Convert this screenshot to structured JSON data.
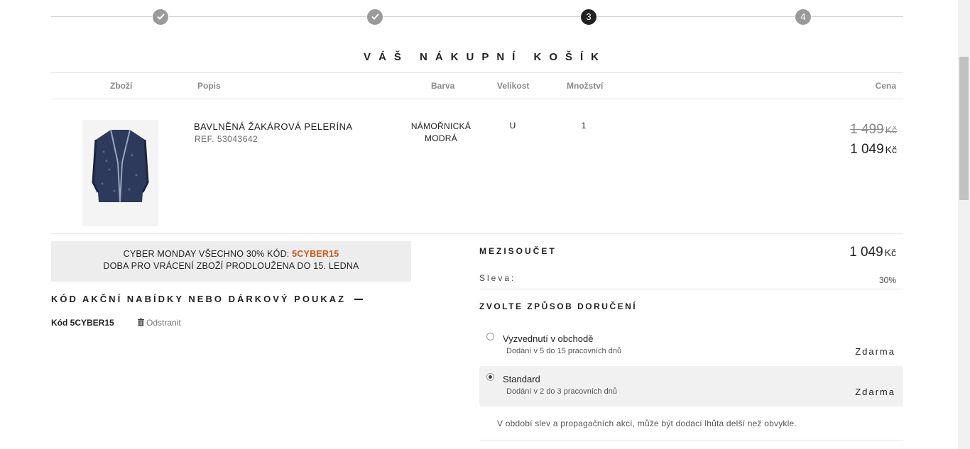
{
  "progress": {
    "steps": [
      {
        "state": "done",
        "icon": "checkmark-icon"
      },
      {
        "state": "done",
        "icon": "checkmark-icon"
      },
      {
        "state": "current",
        "label": "3"
      },
      {
        "state": "upcoming",
        "label": "4"
      }
    ]
  },
  "cart": {
    "title": "VÁŠ NÁKUPNÍ KOŠÍK",
    "columns": {
      "item": "Zboží",
      "description": "Popis",
      "color": "Barva",
      "size": "Velikost",
      "quantity": "Množství",
      "price": "Cena"
    },
    "items": [
      {
        "name": "BAVLNĚNÁ ŽAKÁROVÁ PELERÍNA",
        "ref": "REF. 53043642",
        "color_line1": "NÁMOŘNICKÁ",
        "color_line2": "MODRÁ",
        "size": "U",
        "quantity": "1",
        "price_old": "1 499",
        "price_new": "1 049",
        "currency": "Kč"
      }
    ]
  },
  "promo": {
    "line1_prefix": "CYBER MONDAY VŠECHNO 30% KÓD: ",
    "line1_code": "5CYBER15",
    "line2": "DOBA PRO VRÁCENÍ ZBOŽÍ PRODLOUŽENA DO 15. LEDNA",
    "highlight_color": "#c8591a"
  },
  "voucher": {
    "title": "KÓD AKČNÍ NABÍDKY NEBO DÁRKOVÝ POUKAZ",
    "toggle_icon": "minus-icon",
    "applied_code": "Kód 5CYBER15",
    "remove_label": "Odstranit",
    "remove_icon": "trash-icon"
  },
  "summary": {
    "subtotal_label": "MEZISOUČET",
    "subtotal_value": "1 049",
    "currency": "Kč",
    "discount_label": "Sleva:",
    "discount_value": "30%"
  },
  "shipping": {
    "title": "ZVOLTE ZPŮSOB DORUČENÍ",
    "options": [
      {
        "name": "Vyzvednutí v obchodě",
        "desc": "Dodání v 5 do 15 pracovních dnů",
        "price": "Zdarma",
        "selected": false
      },
      {
        "name": "Standard",
        "desc": "Dodání v 2 do 3 pracovních dnů",
        "price": "Zdarma",
        "selected": true
      }
    ],
    "note": "V období slev a propagačních akcí, může být dodací lhůta delší než obvykle."
  }
}
